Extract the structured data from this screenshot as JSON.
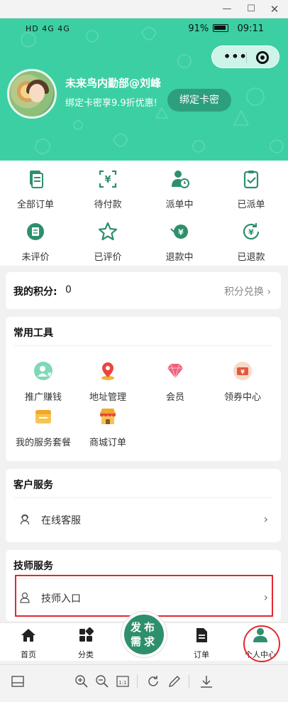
{
  "window": {
    "minimize": "—",
    "maximize": "☐",
    "close": "✕"
  },
  "status": {
    "left": "HD 4G 4G",
    "battery": "91%",
    "time": "09:11"
  },
  "profile": {
    "username": "未来鸟内勤部@刘峰",
    "promo": "绑定卡密享9.9折优惠!",
    "bind_button": "绑定卡密"
  },
  "orders": [
    {
      "label": "全部订单",
      "icon": "document-icon"
    },
    {
      "label": "待付款",
      "icon": "yuan-scan-icon"
    },
    {
      "label": "派单中",
      "icon": "worker-clock-icon"
    },
    {
      "label": "已派单",
      "icon": "clipboard-check-icon"
    },
    {
      "label": "未评价",
      "icon": "comment-icon"
    },
    {
      "label": "已评价",
      "icon": "star-icon"
    },
    {
      "label": "退款中",
      "icon": "refund-icon"
    },
    {
      "label": "已退款",
      "icon": "refunded-icon"
    }
  ],
  "points": {
    "title": "我的积分:",
    "value": "0",
    "link": "积分兑换",
    "chevron": "›"
  },
  "tools": {
    "title": "常用工具",
    "items": [
      {
        "label": "推广赚钱",
        "icon": "promote-icon"
      },
      {
        "label": "地址管理",
        "icon": "location-pin-icon"
      },
      {
        "label": "会员",
        "icon": "diamond-icon"
      },
      {
        "label": "领券中心",
        "icon": "coupon-icon"
      },
      {
        "label": "我的服务套餐",
        "icon": "package-icon"
      },
      {
        "label": "商城订单",
        "icon": "shop-icon"
      }
    ]
  },
  "customer_service": {
    "title": "客户服务",
    "item": "在线客服",
    "chevron": "›"
  },
  "technician": {
    "title": "技师服务",
    "item": "技师入口",
    "chevron": "›"
  },
  "tabbar": {
    "home": "首页",
    "category": "分类",
    "publish_top": "发布",
    "publish_bottom": "需求",
    "orders": "订单",
    "profile": "个人中心"
  },
  "colors": {
    "primary": "#3ccfa4",
    "dark_green": "#2e8f6c",
    "highlight": "#e0282d"
  }
}
